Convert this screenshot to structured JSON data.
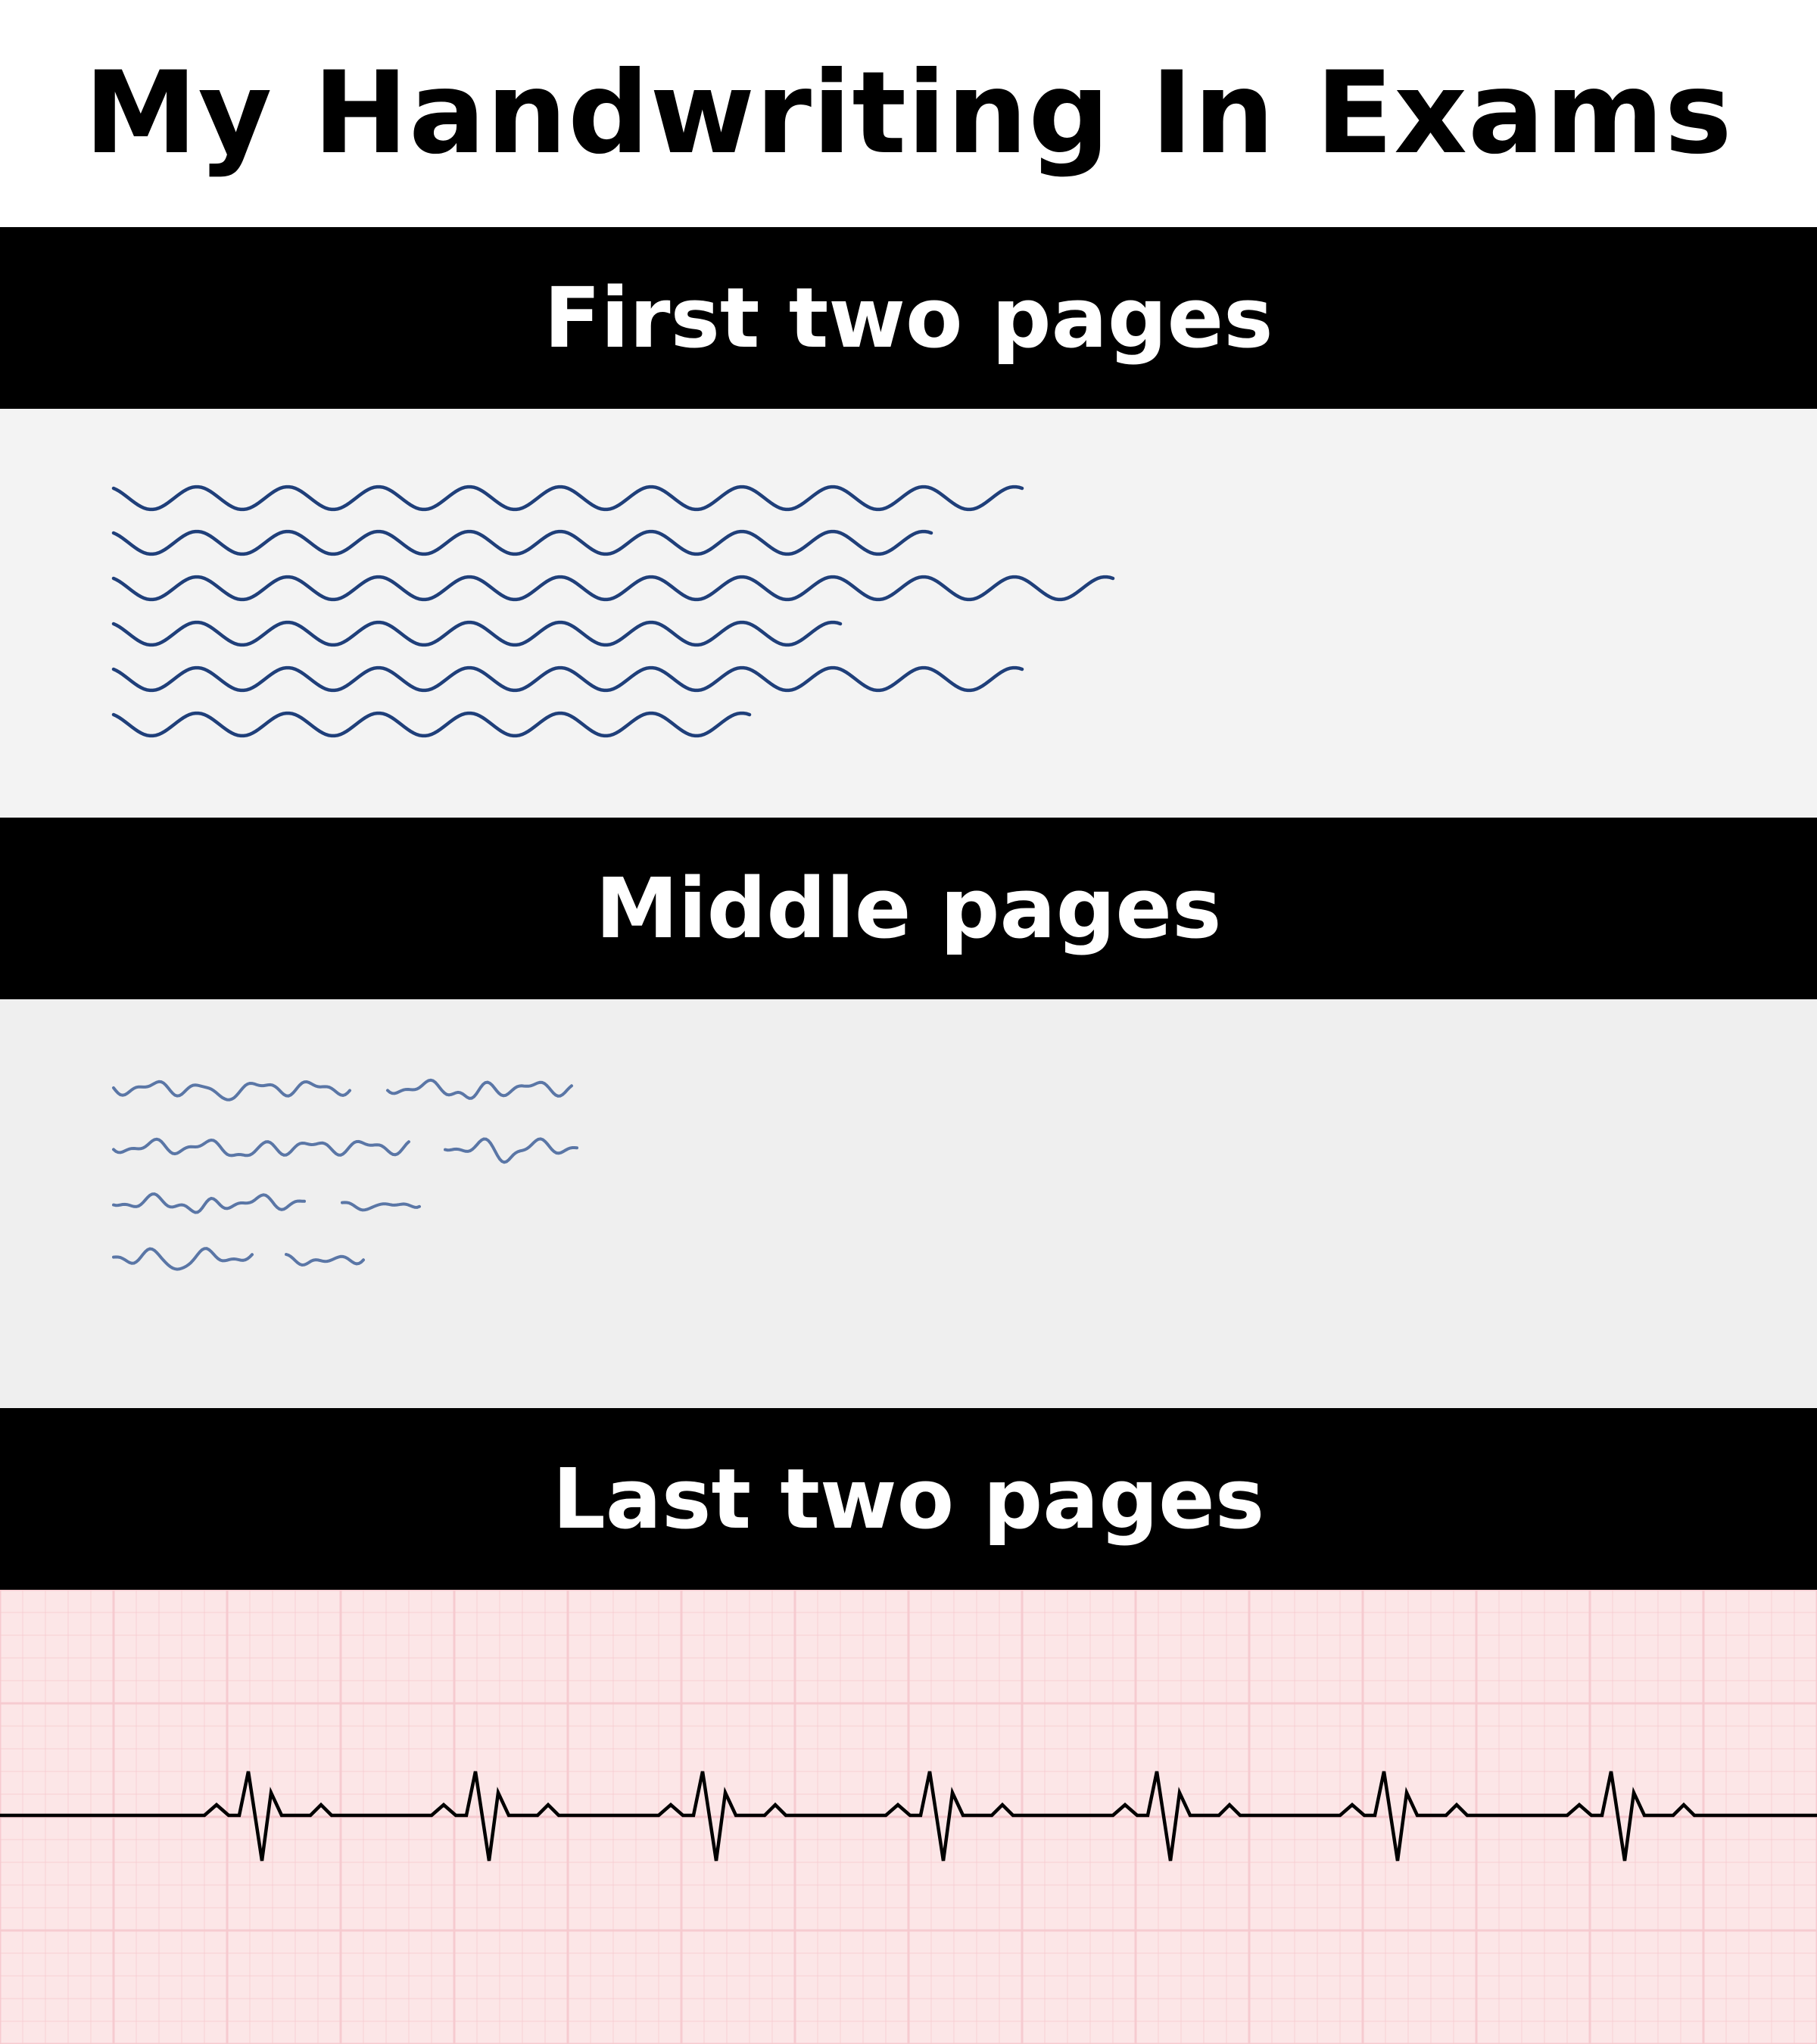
{
  "title": "My Handwriting In Exams",
  "sections": [
    {
      "label": "First two pages",
      "style": "neat wavy lines",
      "ink_color": "#1f3f7a",
      "line_count": 6
    },
    {
      "label": "Middle pages",
      "style": "shorter, sloppier wavy lines",
      "ink_color": "#5a76a6",
      "line_count": 4
    },
    {
      "label": "Last two pages",
      "style": "ECG heartbeat trace on grid paper",
      "ink_color": "#000000",
      "beat_count": 7
    }
  ],
  "colors": {
    "band_bg": "#000000",
    "band_text": "#ffffff",
    "panel1_bg": "#f3f3f3",
    "panel2_bg": "#efefef",
    "ecg_paper": "#fce6e7",
    "ecg_grid": "#f6c9ce"
  }
}
